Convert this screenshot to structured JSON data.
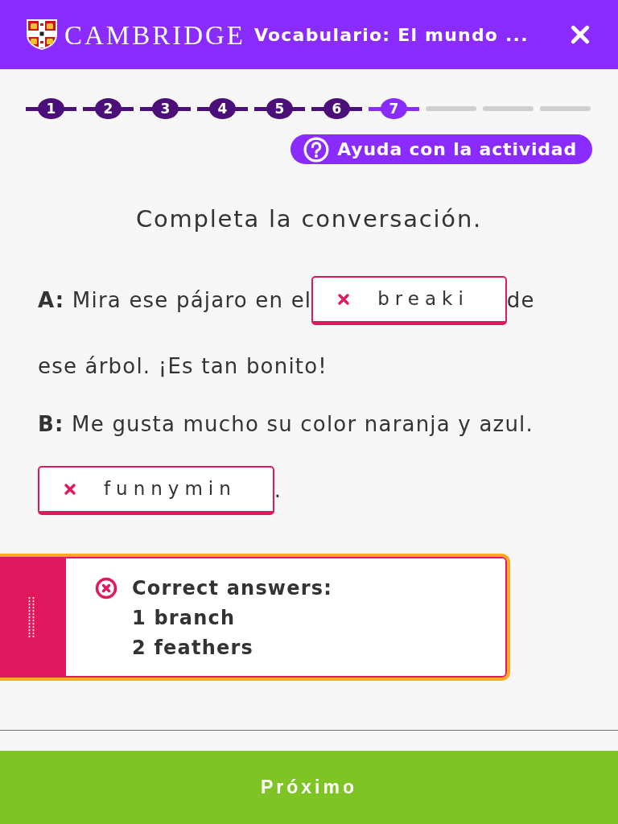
{
  "header": {
    "brand": "CAMBRIDGE",
    "title": "Vocabulario: El mundo ..."
  },
  "progress": {
    "steps": [
      {
        "label": "1",
        "completed": true,
        "selected": false
      },
      {
        "label": "2",
        "completed": true,
        "selected": false
      },
      {
        "label": "3",
        "completed": true,
        "selected": false
      },
      {
        "label": "4",
        "completed": true,
        "selected": false
      },
      {
        "label": "5",
        "completed": true,
        "selected": false
      },
      {
        "label": "6",
        "completed": true,
        "selected": false
      },
      {
        "label": "7",
        "completed": false,
        "selected": true
      },
      {
        "completed": false,
        "selected": false
      },
      {
        "completed": false,
        "selected": false
      },
      {
        "completed": false,
        "selected": false
      }
    ]
  },
  "help_button": {
    "label": "Ayuda con la actividad"
  },
  "instruction": "Completa la conversación.",
  "conversation": {
    "lines": [
      {
        "parts": [
          {
            "kind": "text",
            "text": "**A:** Mira ese pájaro en el"
          },
          {
            "kind": "gap",
            "value": "breaki",
            "correct": false
          },
          {
            "kind": "text",
            "text": "de"
          }
        ]
      },
      {
        "parts": [
          {
            "kind": "text",
            "text": "ese árbol. ¡Es tan bonito!"
          }
        ]
      },
      {
        "parts": [
          {
            "kind": "text",
            "text": "**B:** Me gusta mucho su color naranja y azul."
          }
        ]
      },
      {
        "parts": [
          {
            "kind": "gap",
            "value": "funnymin",
            "correct": false
          },
          {
            "kind": "text",
            "text": "."
          }
        ]
      }
    ]
  },
  "feedback": {
    "correct": false,
    "title": "Correct answers:",
    "answers": [
      "1 branch",
      "2 feathers"
    ]
  },
  "next_button": {
    "label": "Próximo"
  }
}
